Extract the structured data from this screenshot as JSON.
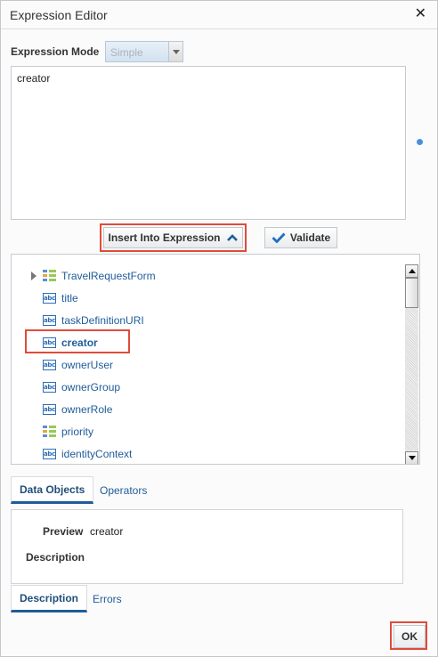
{
  "dialog": {
    "title": "Expression Editor",
    "close_label": "✕"
  },
  "mode": {
    "label": "Expression Mode",
    "selected": "Simple"
  },
  "expression": {
    "value": "creator"
  },
  "buttons": {
    "insert": "Insert Into Expression",
    "validate": "Validate",
    "ok": "OK"
  },
  "tree": {
    "items": [
      {
        "label": "TravelRequestForm",
        "icon": "object-icon",
        "expandable": true
      },
      {
        "label": "title",
        "icon": "abc-icon"
      },
      {
        "label": "taskDefinitionURI",
        "icon": "abc-icon"
      },
      {
        "label": "creator",
        "icon": "abc-icon",
        "selected": true
      },
      {
        "label": "ownerUser",
        "icon": "abc-icon"
      },
      {
        "label": "ownerGroup",
        "icon": "abc-icon"
      },
      {
        "label": "ownerRole",
        "icon": "abc-icon"
      },
      {
        "label": "priority",
        "icon": "object-icon"
      },
      {
        "label": "identityContext",
        "icon": "abc-icon"
      }
    ],
    "abc_text": "abc"
  },
  "tabs_top": [
    "Data Objects",
    "Operators"
  ],
  "preview": {
    "preview_label": "Preview",
    "preview_value": "creator",
    "description_label": "Description"
  },
  "tabs_bottom": [
    "Description",
    "Errors"
  ],
  "colors": {
    "accent": "#1f5c99",
    "highlight": "#e04b3b"
  }
}
